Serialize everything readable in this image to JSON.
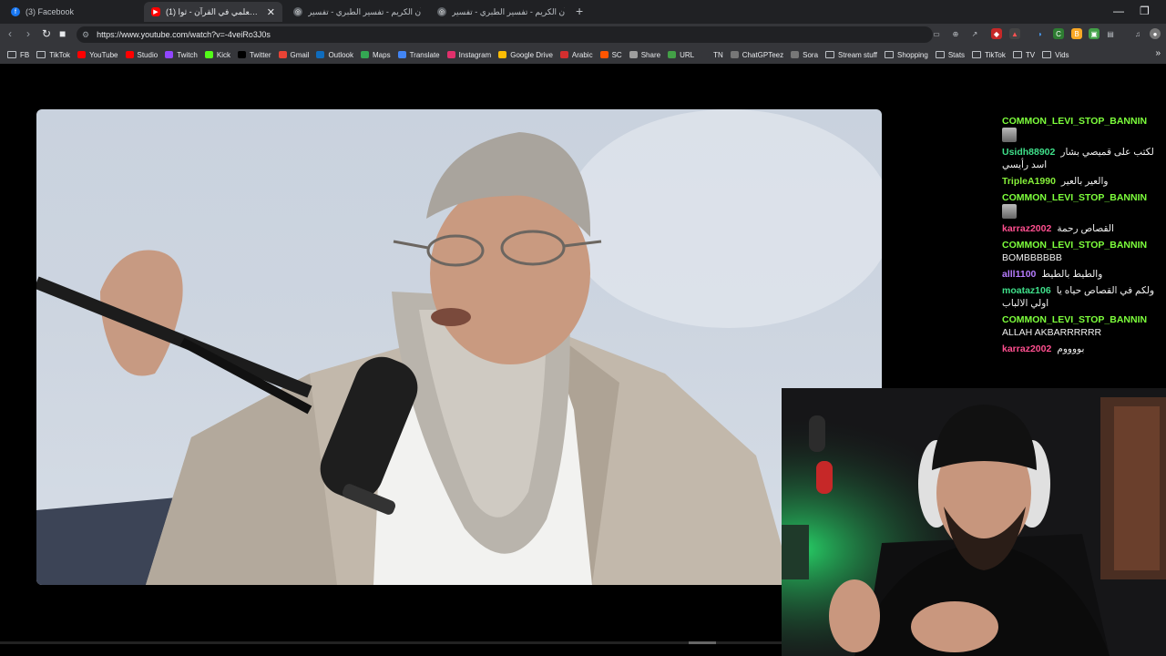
{
  "tabs": [
    {
      "title": "(3) Facebook",
      "favicon": "facebook-icon",
      "active": false
    },
    {
      "title": "(1) الإعجاز العلمي في القرآن - ثوا...",
      "favicon": "youtube-icon",
      "active": true
    },
    {
      "title": "القرآن الكريم - تفسير الطبري - تفسير ...",
      "favicon": "globe-icon",
      "active": false
    },
    {
      "title": "القرآن الكريم - تفسير الطبري - تفسير ...",
      "favicon": "globe-icon",
      "active": false
    }
  ],
  "address_bar": {
    "url": "https://www.youtube.com/watch?v=-4veiRo3J0s"
  },
  "bookmarks": [
    {
      "label": "FB",
      "icon": "folder-icon"
    },
    {
      "label": "TikTok",
      "icon": "folder-icon"
    },
    {
      "label": "YouTube",
      "icon": "youtube-icon"
    },
    {
      "label": "Studio",
      "icon": "youtube-studio-icon"
    },
    {
      "label": "Twitch",
      "icon": "twitch-icon"
    },
    {
      "label": "Kick",
      "icon": "kick-icon"
    },
    {
      "label": "Twitter",
      "icon": "x-icon"
    },
    {
      "label": "Gmail",
      "icon": "gmail-icon"
    },
    {
      "label": "Outlook",
      "icon": "outlook-icon"
    },
    {
      "label": "Maps",
      "icon": "maps-icon"
    },
    {
      "label": "Translate",
      "icon": "translate-icon"
    },
    {
      "label": "Instagram",
      "icon": "instagram-icon"
    },
    {
      "label": "Google Drive",
      "icon": "drive-icon"
    },
    {
      "label": "Arabic",
      "icon": "arabic-icon"
    },
    {
      "label": "SC",
      "icon": "sc-icon"
    },
    {
      "label": "Share",
      "icon": "cloud-icon"
    },
    {
      "label": "URL",
      "icon": "url-icon"
    },
    {
      "label": "TN",
      "icon": "tn-icon"
    },
    {
      "label": "ChatGPTeez",
      "icon": "chatgpt-icon"
    },
    {
      "label": "Sora",
      "icon": "sora-icon"
    },
    {
      "label": "Stream stuff",
      "icon": "folder-icon"
    },
    {
      "label": "Shopping",
      "icon": "folder-icon"
    },
    {
      "label": "Stats",
      "icon": "folder-icon"
    },
    {
      "label": "TikTok",
      "icon": "folder-icon"
    },
    {
      "label": "TV",
      "icon": "folder-icon"
    },
    {
      "label": "Vids",
      "icon": "folder-icon"
    }
  ],
  "chat": [
    {
      "user": "COMMON_LEVI_STOP_BANNIN",
      "color": "#7dff3c",
      "msg": "",
      "emote": true
    },
    {
      "user": "Usidh88902",
      "color": "#3fe08a",
      "msg": "لكتب على قميصي بشار اسد رأيسي",
      "emote": false
    },
    {
      "user": "TripleA1990",
      "color": "#86f03a",
      "msg": "والعير بالعير",
      "emote": false
    },
    {
      "user": "COMMON_LEVI_STOP_BANNIN",
      "color": "#7dff3c",
      "msg": "",
      "emote": true
    },
    {
      "user": "karraz2002",
      "color": "#ff4f8f",
      "msg": "القصاص رحمة",
      "emote": false
    },
    {
      "user": "COMMON_LEVI_STOP_BANNIN",
      "color": "#7dff3c",
      "msg": "BOMBBBBBB",
      "emote": false
    },
    {
      "user": "alll1100",
      "color": "#b67cff",
      "msg": "والطيط بالطيط",
      "emote": false
    },
    {
      "user": "moataz106",
      "color": "#3fe08a",
      "msg": "ولكم في القصاص حياه يا اولي الالباب",
      "emote": false
    },
    {
      "user": "COMMON_LEVI_STOP_BANNIN",
      "color": "#7dff3c",
      "msg": "ALLAH AKBARRRRRR",
      "emote": false
    },
    {
      "user": "karraz2002",
      "color": "#ff4f8f",
      "msg": "بووووم",
      "emote": false
    }
  ]
}
